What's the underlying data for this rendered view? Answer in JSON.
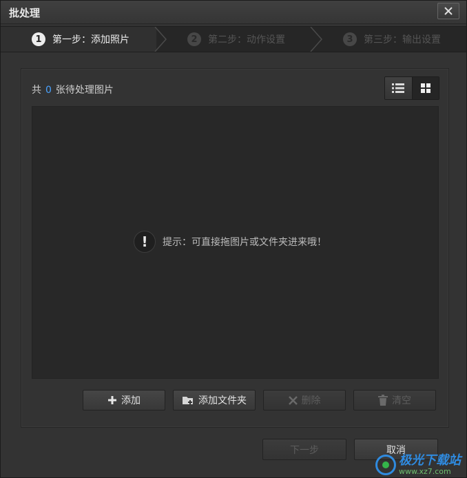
{
  "window": {
    "title": "批处理"
  },
  "steps": [
    {
      "num": "1",
      "label": "第一步：添加照片",
      "active": true
    },
    {
      "num": "2",
      "label": "第二步：动作设置",
      "active": false
    },
    {
      "num": "3",
      "label": "第三步：输出设置",
      "active": false
    }
  ],
  "panel": {
    "count_prefix": "共",
    "count": "0",
    "count_suffix": "张待处理图片",
    "view_modes": [
      "list-view",
      "grid-view"
    ],
    "selected_view": "grid-view"
  },
  "droparea": {
    "hint": "提示：可直接拖图片或文件夹进来哦！"
  },
  "actions": {
    "add": "添加",
    "add_folder": "添加文件夹",
    "delete": "删除",
    "clear": "清空"
  },
  "footer": {
    "next": "下一步",
    "cancel": "取消"
  },
  "watermark": {
    "title": "极光下载站",
    "url": "www.xz7.com"
  },
  "colors": {
    "accent": "#4aa3ff",
    "background": "#333333",
    "droparea": "#282828"
  }
}
